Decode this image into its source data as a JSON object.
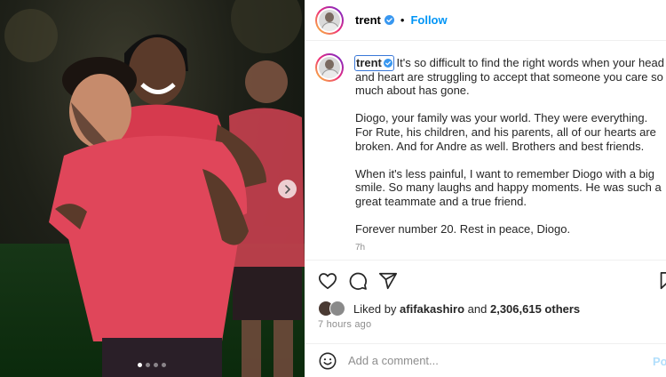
{
  "post": {
    "username": "trent",
    "separator": "•",
    "follow_label": "Follow",
    "caption": {
      "first_line": "It's so difficult to find the right words when your head and heart are struggling to accept that someone you care so much about has gone.",
      "paragraph_2": "Diogo, your family was your world. They were everything. For Rute, his children, and his parents, all of our hearts are broken. And for Andre as well. Brothers and best friends.",
      "paragraph_3": "When it's less painful, I want to remember Diogo with a big smile. So many laughs and happy moments. He was such a great teammate and a true friend.",
      "paragraph_4": "Forever number 20. Rest in peace, Diogo."
    },
    "caption_time": "7h",
    "likes": {
      "liked_by_prefix": "Liked by",
      "liker": "afifakashiro",
      "and": "and",
      "others": "2,306,615 others"
    },
    "posted_ago": "7 hours ago",
    "comment": {
      "placeholder": "Add a comment...",
      "post_label": "Po"
    }
  },
  "carousel": {
    "slide_count": 4,
    "current_slide": 1
  },
  "colors": {
    "accent_blue": "#0095f6",
    "kit_red": "#e0465a",
    "verified_blue": "#3897f0"
  },
  "icons": [
    "verified-badge-icon",
    "heart-icon",
    "comment-icon",
    "share-icon",
    "bookmark-icon",
    "emoji-icon",
    "chevron-right-icon"
  ]
}
